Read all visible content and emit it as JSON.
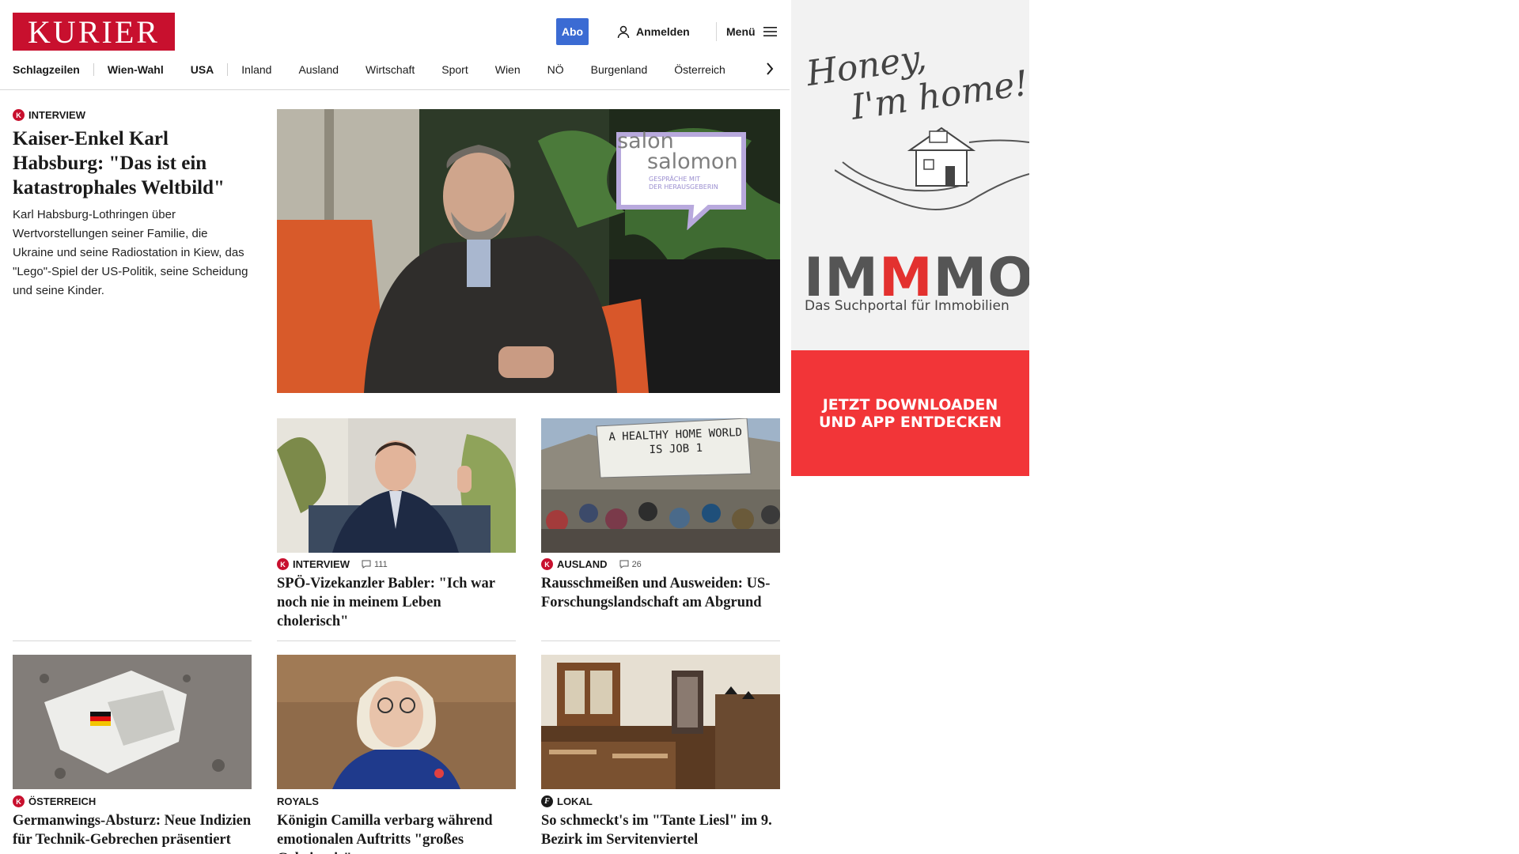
{
  "header": {
    "logo": "KURIER",
    "abo": "Abo",
    "login": "Anmelden",
    "menu": "Menü",
    "nav": [
      "Schlagzeilen",
      "Wien-Wahl",
      "USA",
      "Inland",
      "Ausland",
      "Wirtschaft",
      "Sport",
      "Wien",
      "NÖ",
      "Burgenland",
      "Österreich"
    ]
  },
  "lead": {
    "kicker": "INTERVIEW",
    "title": "Kaiser-Enkel Karl Habsburg: \"Das ist ein katastrophales Weltbild\"",
    "teaser": "Karl Habsburg-Lothringen über Wertvorstellungen seiner Familie, die Ukraine und seine Radiostation in Kiew, das \"Lego\"-Spiel der US-Politik, seine Scheidung und seine Kinder.",
    "image_overlay": {
      "line1": "salon",
      "line2": "salomon",
      "sub1": "GESPRÄCHE MIT",
      "sub2": "DER HERAUSGEBERIN"
    }
  },
  "articles": [
    {
      "kicker": "INTERVIEW",
      "comments": "111",
      "title": "SPÖ-Vizekanzler Babler: \"Ich war noch nie in meinem Leben cholerisch\""
    },
    {
      "kicker": "AUSLAND",
      "comments": "26",
      "title": "Rausschmeißen und Ausweiden: US-Forschungslandschaft am Abgrund",
      "sign_line1": "A HEALTHY HOME WORLD",
      "sign_line2": "IS JOB 1"
    },
    {
      "kicker": "ÖSTERREICH",
      "title": "Germanwings-Absturz: Neue Indizien für Technik-Gebrechen präsentiert"
    },
    {
      "kicker": "ROYALS",
      "title": "Königin Camilla verbarg während emotionalen Auftritts \"großes Geheimnis\""
    },
    {
      "kicker": "LOKAL",
      "title": "So schmeckt's im \"Tante Liesl\" im 9. Bezirk im Servitenviertel"
    }
  ],
  "ad": {
    "script_line1": "Honey,",
    "script_line2": "I'm home!",
    "brand_a": "IM",
    "brand_b": "M",
    "brand_c": "MO",
    "subtitle": "Das Suchportal für Immobilien",
    "cta_line1": "JETZT DOWNLOADEN",
    "cta_line2": "UND APP ENTDECKEN"
  },
  "colors": {
    "brand": "#c8102e",
    "abo": "#3b6bd3",
    "ad_red": "#f23538"
  }
}
